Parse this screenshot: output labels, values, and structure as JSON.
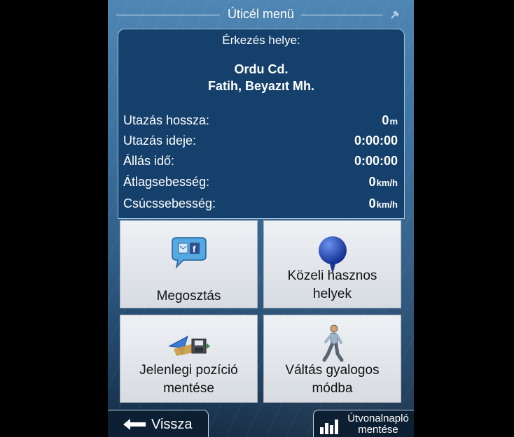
{
  "header": {
    "title": "Úticél menü"
  },
  "info": {
    "arrival_label": "Érkezés helye:",
    "address_line1": "Ordu Cd.",
    "address_line2": "Fatih, Beyazıt Mh.",
    "rows": [
      {
        "label": "Utazás hossza:",
        "value": "0",
        "unit": "m"
      },
      {
        "label": "Utazás ideje:",
        "value": "0:00:00",
        "unit": ""
      },
      {
        "label": "Állás idő:",
        "value": "0:00:00",
        "unit": ""
      },
      {
        "label": "Átlagsebesség:",
        "value": "0",
        "unit": "km/h"
      },
      {
        "label": "Csúcssebesség:",
        "value": "0",
        "unit": "km/h"
      }
    ]
  },
  "tiles": {
    "share": {
      "line1": "Megosztás",
      "icon": "share-bubble-icon"
    },
    "nearby": {
      "line1": "Közeli hasznos",
      "line2": "helyek",
      "icon": "map-pin-icon"
    },
    "save_position": {
      "line1": "Jelenlegi pozíció",
      "line2": "mentése",
      "icon": "save-location-icon"
    },
    "walk_mode": {
      "line1": "Váltás gyalogos",
      "line2": "módba",
      "icon": "walking-person-icon"
    }
  },
  "footer": {
    "back_label": "Vissza",
    "log_line1": "Útvonalnapló",
    "log_line2": "mentése"
  },
  "colors": {
    "panel": "#14406b",
    "tile": "#e4e8ec",
    "background": "#3c6f9c"
  }
}
